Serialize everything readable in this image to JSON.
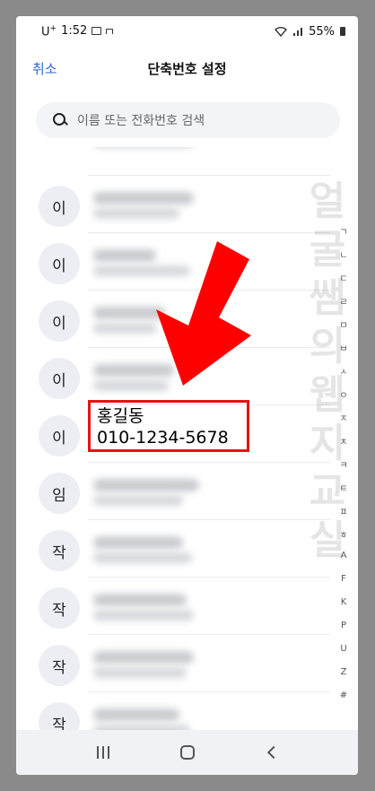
{
  "status_bar": {
    "carrier": "U",
    "carrier_sup": "+",
    "time": "1:52",
    "battery": "55%"
  },
  "header": {
    "cancel_label": "취소",
    "title": "단축번호 설정"
  },
  "search": {
    "placeholder": "이름 또는 전화번호 검색"
  },
  "contacts": [
    {
      "initial": "이"
    },
    {
      "initial": "이"
    },
    {
      "initial": "이"
    },
    {
      "initial": "이"
    },
    {
      "initial": "이"
    },
    {
      "initial": "임"
    },
    {
      "initial": "작"
    },
    {
      "initial": "작"
    },
    {
      "initial": "작"
    },
    {
      "initial": "작"
    }
  ],
  "highlighted_contact": {
    "name": "홍길동",
    "phone": "010-1234-5678"
  },
  "index_letters": [
    "ㄱ",
    "ㄴ",
    "ㄷ",
    "ㄹ",
    "ㅁ",
    "ㅂ",
    "ㅅ",
    "ㅇ",
    "ㅈ",
    "ㅊ",
    "ㅋ",
    "ㅌ",
    "ㅍ",
    "ㅎ",
    "A",
    "F",
    "K",
    "P",
    "U",
    "Z",
    "#"
  ],
  "watermark": [
    "얼",
    "굴",
    "쌤",
    "의",
    "웹",
    "지",
    "교",
    "실"
  ],
  "colors": {
    "accent": "#2f6bd1",
    "highlight": "#e31414",
    "arrow": "#ff0000"
  }
}
